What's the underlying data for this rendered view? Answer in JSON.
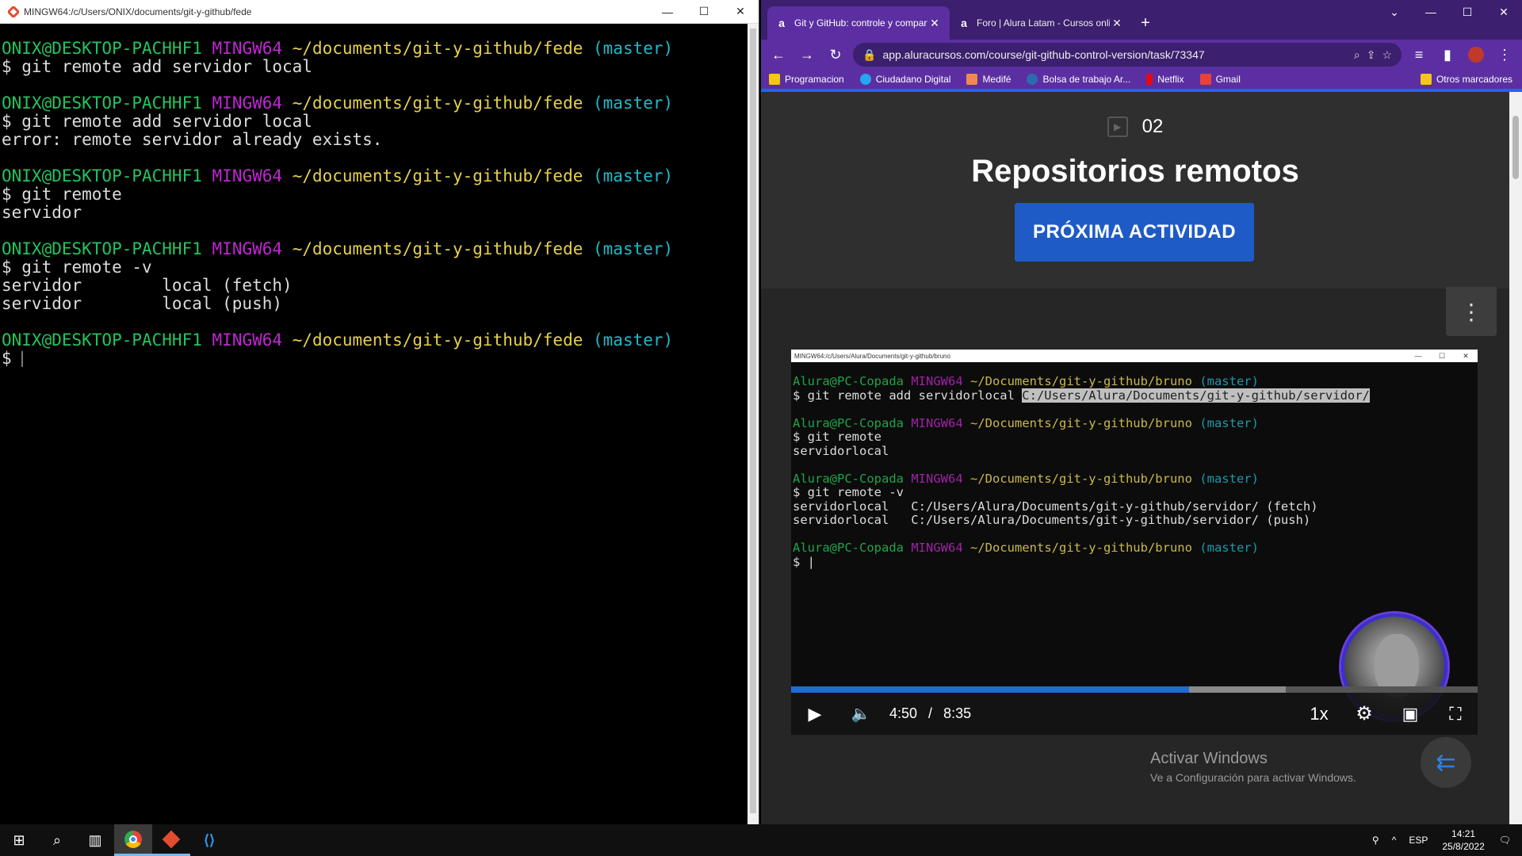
{
  "terminal": {
    "title": "MINGW64:/c/Users/ONIX/documents/git-y-github/fede",
    "prompt": {
      "user": "ONIX@DESKTOP-PACHHF1",
      "system": "MINGW64",
      "path": "~/documents/git-y-github/fede",
      "branch": "(master)"
    },
    "commands": [
      {
        "cmd": "$ git remote add servidor local",
        "output": []
      },
      {
        "cmd": "$ git remote add servidor local",
        "output": [
          "error: remote servidor already exists."
        ]
      },
      {
        "cmd": "$ git remote",
        "output": [
          "servidor"
        ]
      },
      {
        "cmd": "$ git remote -v",
        "output": [
          "servidor        local (fetch)",
          "servidor        local (push)"
        ]
      }
    ],
    "final_prompt": "$"
  },
  "browser": {
    "tabs": [
      {
        "label": "Git y GitHub: controle y compart",
        "favicon": "a"
      },
      {
        "label": "Foro | Alura Latam - Cursos onlin",
        "favicon": "a"
      }
    ],
    "url": "app.aluracursos.com/course/git-github-control-version/task/73347",
    "bookmarks": [
      {
        "label": "Programacion",
        "color": "#f5c518"
      },
      {
        "label": "Ciudadano Digital",
        "color": "#22a7f0"
      },
      {
        "label": "Medifé",
        "color": "#f08a4b"
      },
      {
        "label": "Bolsa de trabajo Ar...",
        "color": "#2b6cb0"
      },
      {
        "label": "Netflix",
        "color": "#e50914"
      },
      {
        "label": "Gmail",
        "color": "#ea4335"
      }
    ],
    "other_bookmarks": "Otros marcadores"
  },
  "lesson": {
    "number": "02",
    "title": "Repositorios remotos",
    "next_button": "PRÓXIMA ACTIVIDAD"
  },
  "video": {
    "window_title": "MINGW64:/c/Users/Alura/Documents/git-y-github/bruno",
    "prompt": {
      "user": "Alura@PC-Copada",
      "system": "MINGW64",
      "path": "~/Documents/git-y-github/bruno",
      "branch": "(master)"
    },
    "line1_cmd": "$ git remote add servidorlocal ",
    "line1_highlight": "C:/Users/Alura/Documents/git-y-github/servidor/",
    "line2_cmd": "$ git remote",
    "line2_out": "servidorlocal",
    "line3_cmd": "$ git remote -v",
    "line3_out1": "servidorlocal   C:/Users/Alura/Documents/git-y-github/servidor/ (fetch)",
    "line3_out2": "servidorlocal   C:/Users/Alura/Documents/git-y-github/servidor/ (push)",
    "final_prompt": "$",
    "current_time": "4:50",
    "separator": "/",
    "duration": "8:35",
    "speed": "1x",
    "progress_fraction": 0.58,
    "buffered_fraction": 0.72
  },
  "watermark": {
    "line1": "Activar Windows",
    "line2": "Ve a Configuración para activar Windows."
  },
  "taskbar": {
    "language": "ESP",
    "time": "14:21",
    "date": "25/8/2022"
  }
}
